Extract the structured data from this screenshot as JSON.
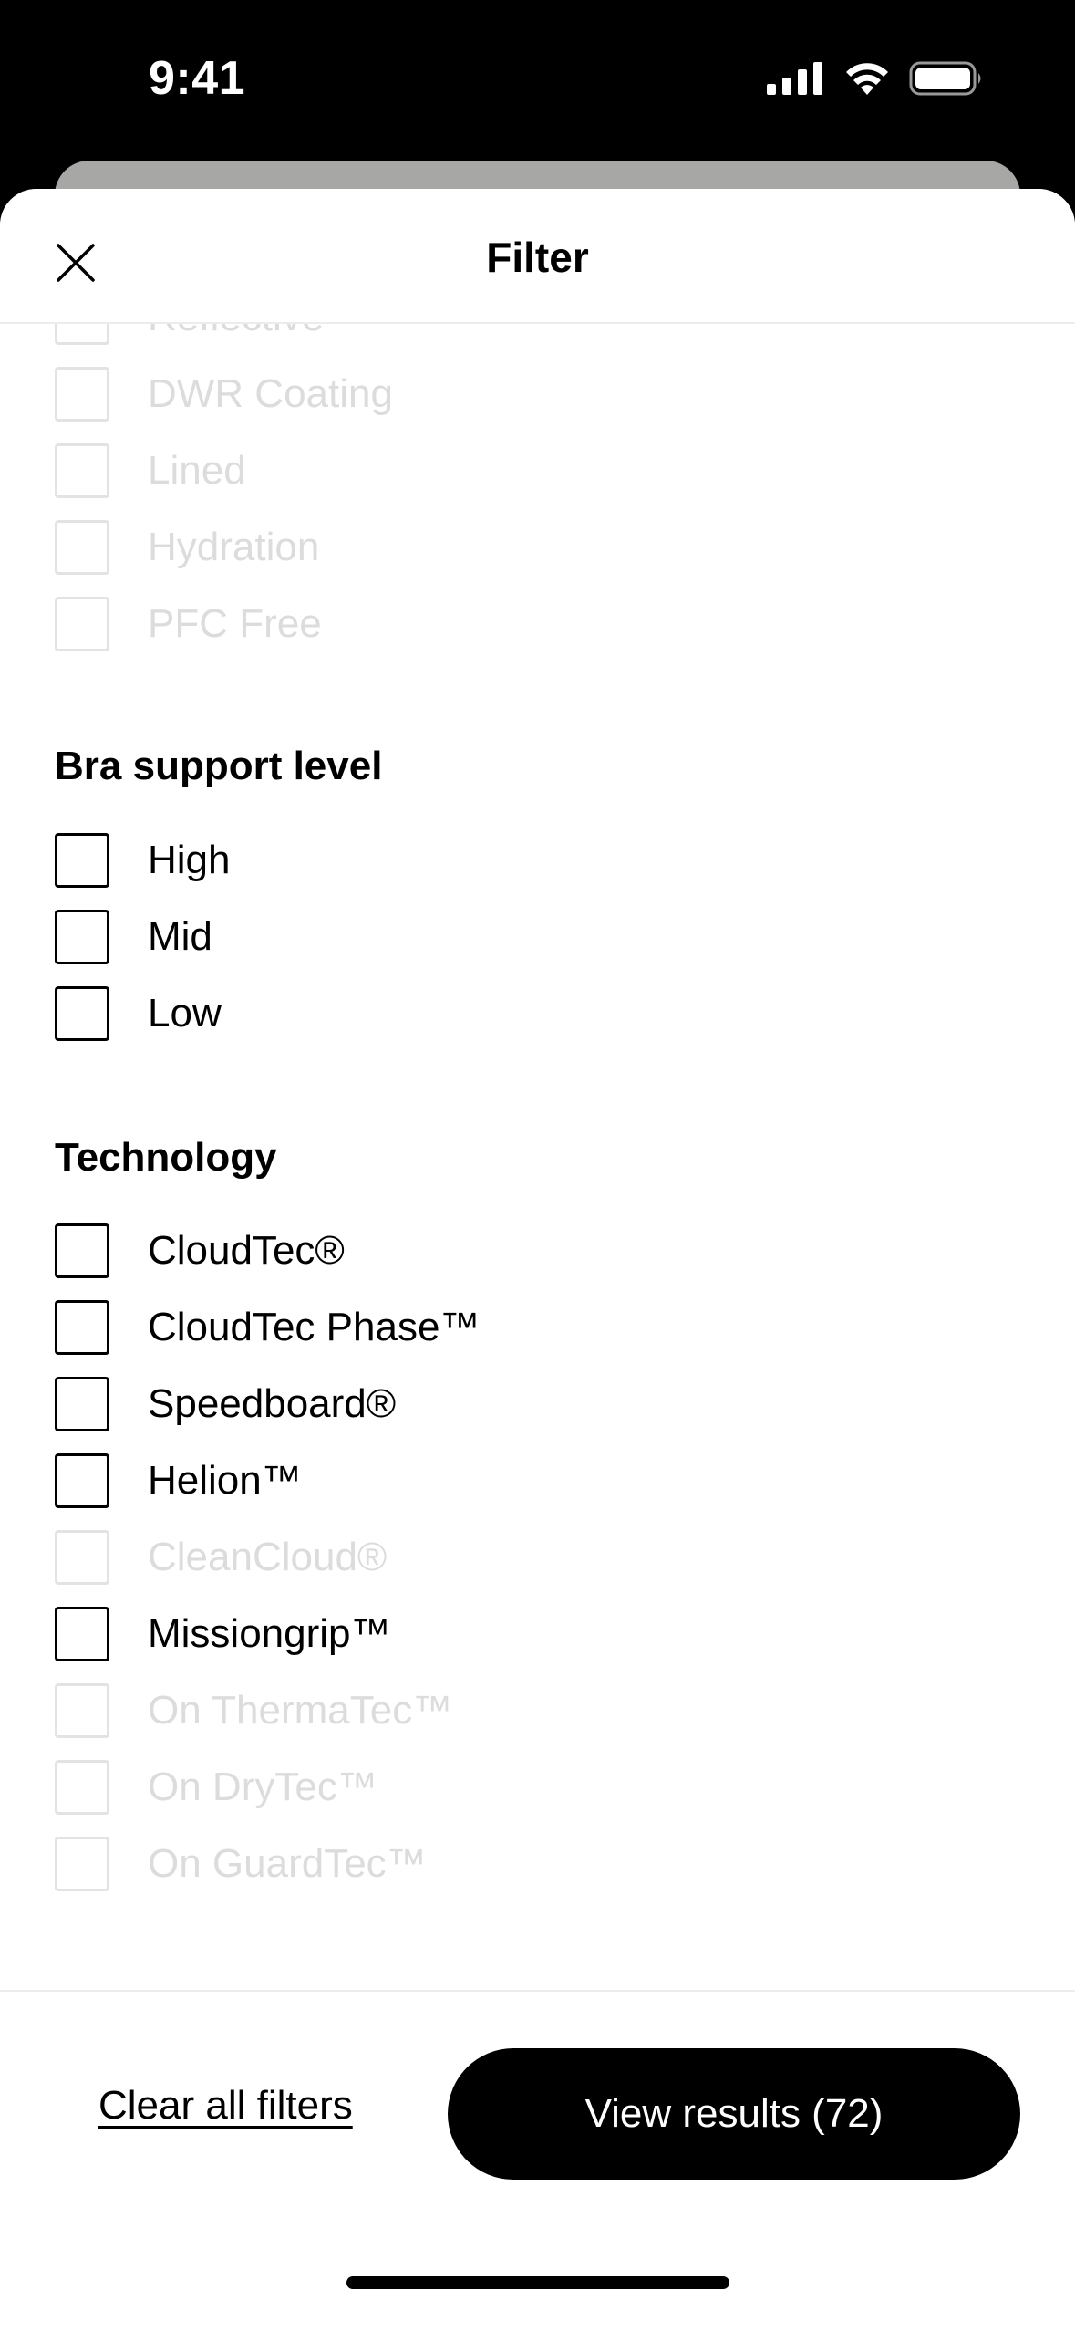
{
  "status_bar": {
    "time": "9:41"
  },
  "header": {
    "title": "Filter",
    "close_icon": "close-icon"
  },
  "features": {
    "items": [
      {
        "label": "Reflective",
        "enabled": false
      },
      {
        "label": "DWR Coating",
        "enabled": false
      },
      {
        "label": "Lined",
        "enabled": false
      },
      {
        "label": "Hydration",
        "enabled": false
      },
      {
        "label": "PFC Free",
        "enabled": false
      }
    ]
  },
  "bra_support": {
    "title": "Bra support level",
    "items": [
      {
        "label": "High",
        "enabled": true
      },
      {
        "label": "Mid",
        "enabled": true
      },
      {
        "label": "Low",
        "enabled": true
      }
    ]
  },
  "technology": {
    "title": "Technology",
    "items": [
      {
        "label": "CloudTec®",
        "enabled": true
      },
      {
        "label": "CloudTec Phase™",
        "enabled": true
      },
      {
        "label": "Speedboard®",
        "enabled": true
      },
      {
        "label": "Helion™",
        "enabled": true
      },
      {
        "label": "CleanCloud®",
        "enabled": false
      },
      {
        "label": "Missiongrip™",
        "enabled": true
      },
      {
        "label": "On ThermaTec™",
        "enabled": false
      },
      {
        "label": "On DryTec™",
        "enabled": false
      },
      {
        "label": "On GuardTec™",
        "enabled": false
      }
    ]
  },
  "footer": {
    "clear_label": "Clear all filters",
    "view_results_label": "View results (72)"
  },
  "colors": {
    "primary": "#000000",
    "background": "#ffffff",
    "disabled": "#dcdcdc",
    "behind_sheet": "#a7a7a5"
  }
}
